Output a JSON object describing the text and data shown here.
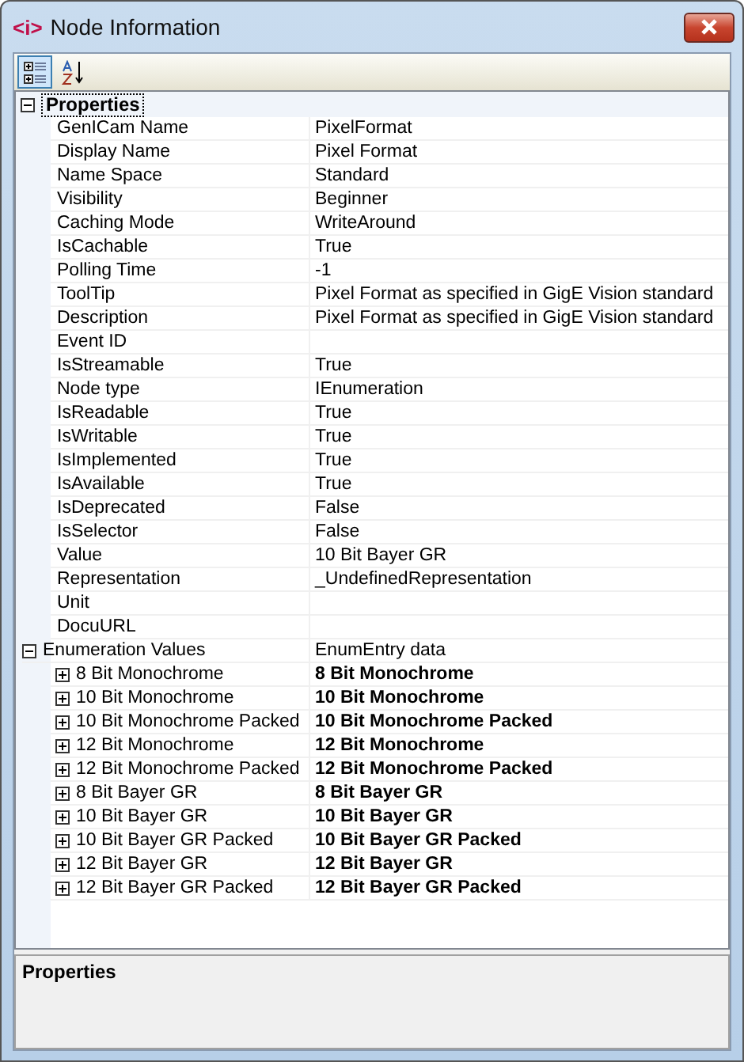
{
  "window": {
    "title": "Node Information",
    "title_icon": "<i>"
  },
  "toolbar": [
    {
      "kind": "categorized",
      "selected": true
    },
    {
      "kind": "alphabetical",
      "selected": false
    }
  ],
  "grid": {
    "category": {
      "label": "Properties",
      "expanded": true
    },
    "rows": [
      {
        "kind": "property",
        "name": "GenICam Name",
        "value": "PixelFormat"
      },
      {
        "kind": "property",
        "name": "Display Name",
        "value": "Pixel Format"
      },
      {
        "kind": "property",
        "name": "Name Space",
        "value": "Standard"
      },
      {
        "kind": "property",
        "name": "Visibility",
        "value": "Beginner"
      },
      {
        "kind": "property",
        "name": "Caching Mode",
        "value": "WriteAround"
      },
      {
        "kind": "property",
        "name": "IsCachable",
        "value": "True"
      },
      {
        "kind": "property",
        "name": "Polling Time",
        "value": "-1"
      },
      {
        "kind": "property",
        "name": "ToolTip",
        "value": "Pixel Format as specified in GigE Vision standard"
      },
      {
        "kind": "property",
        "name": "Description",
        "value": "Pixel Format as specified in GigE Vision standard"
      },
      {
        "kind": "property",
        "name": "Event ID"
      },
      {
        "kind": "property",
        "name": "IsStreamable",
        "value": "True"
      },
      {
        "kind": "property",
        "name": "Node type",
        "value": "IEnumeration"
      },
      {
        "kind": "property",
        "name": "IsReadable",
        "value": "True"
      },
      {
        "kind": "property",
        "name": "IsWritable",
        "value": "True"
      },
      {
        "kind": "property",
        "name": "IsImplemented",
        "value": "True"
      },
      {
        "kind": "property",
        "name": "IsAvailable",
        "value": "True"
      },
      {
        "kind": "property",
        "name": "IsDeprecated",
        "value": "False"
      },
      {
        "kind": "property",
        "name": "IsSelector",
        "value": "False"
      },
      {
        "kind": "property",
        "name": "Value",
        "value": "10 Bit Bayer GR"
      },
      {
        "kind": "property",
        "name": "Representation",
        "value": "_UndefinedRepresentation"
      },
      {
        "kind": "property",
        "name": "Unit"
      },
      {
        "kind": "property",
        "name": "DocuURL"
      },
      {
        "kind": "group",
        "name": "Enumeration Values",
        "value": "EnumEntry data",
        "expanded": true,
        "children": [
          {
            "name": "8 Bit Monochrome",
            "value": "8 Bit Monochrome",
            "expanded": false
          },
          {
            "name": "10 Bit Monochrome",
            "value": "10 Bit Monochrome",
            "expanded": false
          },
          {
            "name": "10 Bit Monochrome Packed",
            "value": "10 Bit Monochrome Packed",
            "expanded": false
          },
          {
            "name": "12 Bit Monochrome",
            "value": "12 Bit Monochrome",
            "expanded": false
          },
          {
            "name": "12 Bit Monochrome Packed",
            "value": "12 Bit Monochrome Packed",
            "expanded": false
          },
          {
            "name": "8 Bit Bayer GR",
            "value": "8 Bit Bayer GR",
            "expanded": false
          },
          {
            "name": "10 Bit Bayer GR",
            "value": "10 Bit Bayer GR",
            "expanded": false
          },
          {
            "name": "10 Bit Bayer GR Packed",
            "value": "10 Bit Bayer GR Packed",
            "expanded": false
          },
          {
            "name": "12 Bit Bayer GR",
            "value": "12 Bit Bayer GR",
            "expanded": false
          },
          {
            "name": "12 Bit Bayer GR Packed",
            "value": "12 Bit Bayer GR Packed",
            "expanded": false
          }
        ]
      }
    ]
  },
  "description_panel": {
    "title": "Properties"
  }
}
